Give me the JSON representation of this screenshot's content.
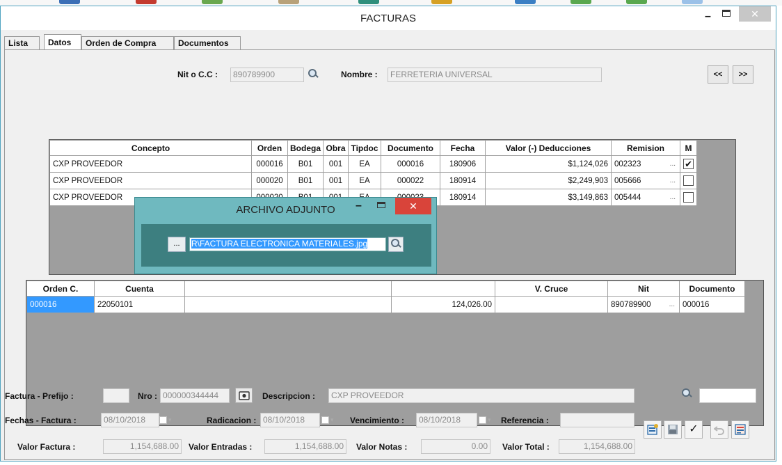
{
  "window": {
    "title": "FACTURAS",
    "minimize": "–",
    "close": "✕"
  },
  "tabs": [
    {
      "label": "Lista"
    },
    {
      "label": "Datos"
    },
    {
      "label": "Orden de Compra"
    },
    {
      "label": "Documentos"
    }
  ],
  "header": {
    "nit_label": "Nit o C.C :",
    "nit_value": "890789900",
    "nombre_label": "Nombre :",
    "nombre_value": "FERRETERIA UNIVERSAL",
    "prev_label": "<<",
    "next_label": ">>"
  },
  "grid1": {
    "columns": [
      "Concepto",
      "Orden",
      "Bodega",
      "Obra",
      "Tipdoc",
      "Documento",
      "Fecha",
      "Valor (-) Deducciones",
      "Remision",
      "M"
    ],
    "rows": [
      {
        "concepto": "CXP PROVEEDOR",
        "orden": "000016",
        "bodega": "B01",
        "obra": "001",
        "tipdoc": "EA",
        "documento": "000016",
        "fecha": "180906",
        "valor": "$1,124,026",
        "remision": "002323",
        "ellipsis": "...",
        "check": "✔"
      },
      {
        "concepto": "CXP PROVEEDOR",
        "orden": "000020",
        "bodega": "B01",
        "obra": "001",
        "tipdoc": "EA",
        "documento": "000022",
        "fecha": "180914",
        "valor": "$2,249,903",
        "remision": "005666",
        "ellipsis": "...",
        "check": ""
      },
      {
        "concepto": "CXP PROVEEDOR",
        "orden": "000020",
        "bodega": "B01",
        "obra": "001",
        "tipdoc": "EA",
        "documento": "000023",
        "fecha": "180914",
        "valor": "$3,149,863",
        "remision": "005444",
        "ellipsis": "...",
        "check": ""
      }
    ]
  },
  "grid2": {
    "columns": [
      "Orden C.",
      "Cuenta",
      "",
      "",
      "V. Cruce",
      "Nit",
      "Documento"
    ],
    "rows": [
      {
        "orden": "000016",
        "cuenta": "22050101",
        "valor": "124,026.00",
        "cruce": "",
        "nit": "890789900",
        "ellipsis": "...",
        "documento": "000016"
      }
    ]
  },
  "dialog": {
    "title": "ARCHIVO ADJUNTO",
    "minimize": "–",
    "close": "✕",
    "browse_label": "...",
    "path_value": "R\\FACTURA ELECTRONICA MATERIALES.jpg"
  },
  "footer": {
    "prefijo_label": "Factura - Prefijo :",
    "prefijo_value": "",
    "nro_label": "Nro :",
    "nro_value": "000000344444",
    "descripcion_label": "Descripcion :",
    "descripcion_value": "CXP PROVEEDOR",
    "fechas_label": "Fechas - Factura :",
    "fecha_factura": "08/10/2018",
    "radicacion_label": "Radicacion :",
    "radicacion_value": "08/10/2018",
    "vencimiento_label": "Vencimiento :",
    "vencimiento_value": "08/10/2018",
    "referencia_label": "Referencia :",
    "referencia_value": "",
    "valor_factura_label": "Valor Factura :",
    "valor_factura": "1,154,688.00",
    "valor_entradas_label": "Valor Entradas :",
    "valor_entradas": "1,154,688.00",
    "valor_notas_label": "Valor Notas :",
    "valor_notas": "0.00",
    "valor_total_label": "Valor Total :",
    "valor_total": "1,154,688.00",
    "search_value": ""
  },
  "colors": {
    "dialog_bg": "#6fb9bf",
    "dialog_body": "#3d7f80",
    "close_red": "#d9443a",
    "selection": "#3399ff"
  },
  "icons": [
    "search-icon",
    "camera-icon",
    "zoom-search-icon",
    "new-doc-icon",
    "save-icon",
    "check-icon",
    "undo-icon",
    "print-icon"
  ]
}
